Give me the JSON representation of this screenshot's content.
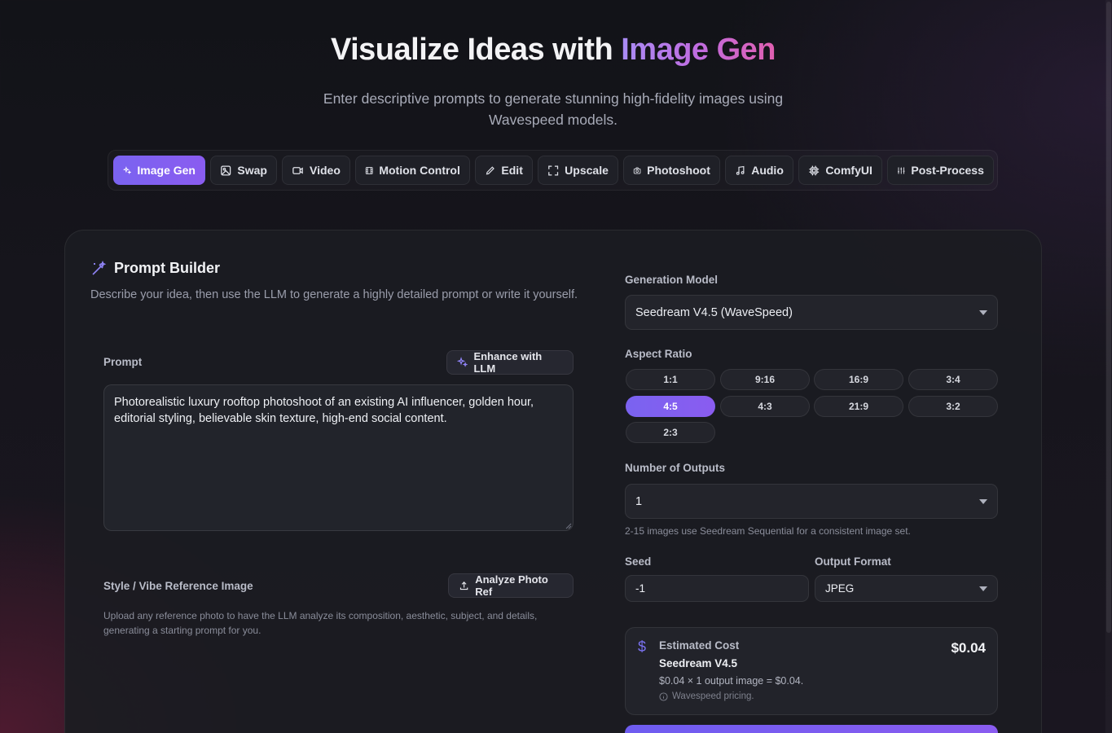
{
  "hero": {
    "title_prefix": "Visualize Ideas with ",
    "title_accent": "Image Gen",
    "subtitle": "Enter descriptive prompts to generate stunning high-fidelity images using Wavespeed models."
  },
  "tabs": [
    {
      "label": "Image Gen",
      "icon": "sparkles-icon",
      "active": true
    },
    {
      "label": "Swap",
      "icon": "image-icon",
      "active": false
    },
    {
      "label": "Video",
      "icon": "video-icon",
      "active": false
    },
    {
      "label": "Motion Control",
      "icon": "film-icon",
      "active": false
    },
    {
      "label": "Edit",
      "icon": "pencil-icon",
      "active": false
    },
    {
      "label": "Upscale",
      "icon": "expand-icon",
      "active": false
    },
    {
      "label": "Photoshoot",
      "icon": "camera-icon",
      "active": false
    },
    {
      "label": "Audio",
      "icon": "music-icon",
      "active": false
    },
    {
      "label": "ComfyUI",
      "icon": "cpu-icon",
      "active": false
    },
    {
      "label": "Post-Process",
      "icon": "sliders-icon",
      "active": false
    }
  ],
  "prompt_builder": {
    "title": "Prompt Builder",
    "description": "Describe your idea, then use the LLM to generate a highly detailed prompt or write it yourself.",
    "prompt_label": "Prompt",
    "enhance_button": "Enhance with LLM",
    "prompt_value": "Photorealistic luxury rooftop photoshoot of an existing AI influencer, golden hour, editorial styling, believable skin texture, high-end social content.",
    "reference_label": "Style / Vibe Reference Image",
    "analyze_button": "Analyze Photo Ref",
    "reference_help": "Upload any reference photo to have the LLM analyze its composition, aesthetic, subject, and details, generating a starting prompt for you."
  },
  "settings": {
    "model_label": "Generation Model",
    "model_value": "Seedream V4.5 (WaveSpeed)",
    "aspect_label": "Aspect Ratio",
    "aspect_ratios": [
      "1:1",
      "9:16",
      "16:9",
      "3:4",
      "4:5",
      "4:3",
      "21:9",
      "3:2",
      "2:3"
    ],
    "aspect_selected": "4:5",
    "outputs_label": "Number of Outputs",
    "outputs_value": "1",
    "outputs_help": "2-15 images use Seedream Sequential for a consistent image set.",
    "seed_label": "Seed",
    "seed_value": "-1",
    "format_label": "Output Format",
    "format_value": "JPEG"
  },
  "cost": {
    "label": "Estimated Cost",
    "model": "Seedream V4.5",
    "calc": "$0.04 × 1 output image = $0.04.",
    "note": "Wavespeed pricing.",
    "price": "$0.04"
  },
  "colors": {
    "accent": "#7a63f0",
    "accent_pink": "#e05fb0",
    "background": "#14141a"
  }
}
